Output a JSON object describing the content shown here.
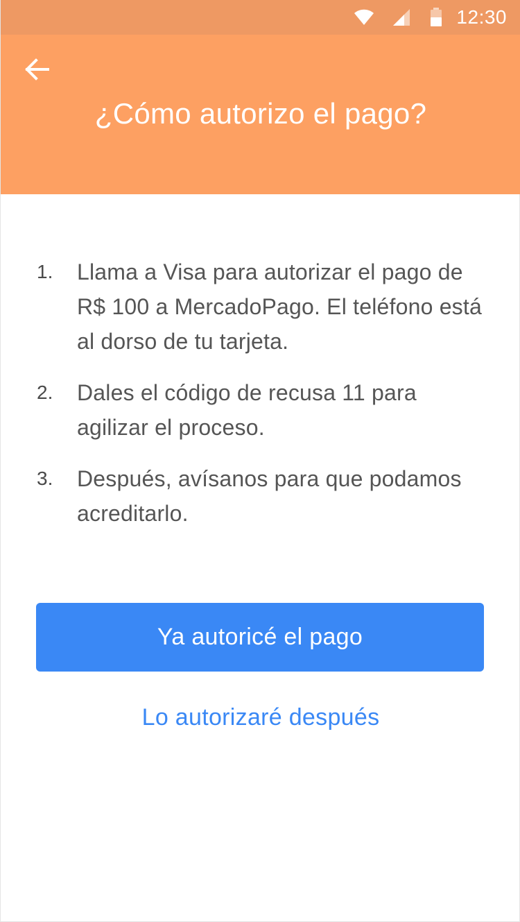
{
  "status_bar": {
    "time": "12:30",
    "icons": [
      "wifi-icon",
      "signal-icon",
      "battery-icon"
    ]
  },
  "header": {
    "back_icon": "arrow-left-icon",
    "title": "¿Cómo autorizo el pago?"
  },
  "steps": [
    {
      "number": "1.",
      "text": "Llama a Visa para autorizar el pago de R$ 100 a MercadoPago. El teléfono está al dorso de tu tarjeta."
    },
    {
      "number": "2.",
      "text": "Dales el código de recusa 11 para agilizar el proceso."
    },
    {
      "number": "3.",
      "text": "Después, avísanos para que podamos acreditarlo."
    }
  ],
  "actions": {
    "primary_label": "Ya autoricé el pago",
    "secondary_label": "Lo autorizaré después"
  },
  "colors": {
    "status_bar": "#ee9963",
    "header": "#fda062",
    "primary": "#3a88f5",
    "body_text": "#555555"
  }
}
